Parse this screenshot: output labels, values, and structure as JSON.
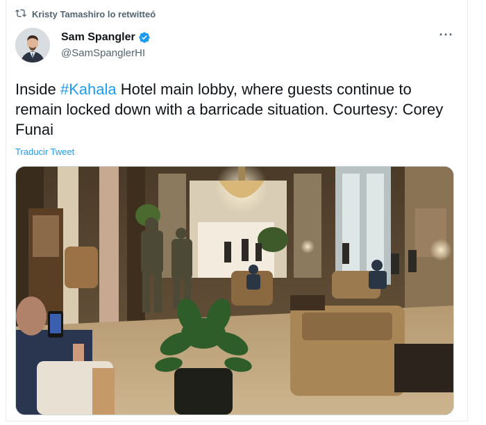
{
  "retweet": {
    "text": "Kristy Tamashiro lo retwitteó",
    "icon": "retweet-icon"
  },
  "author": {
    "display_name": "Sam Spangler",
    "handle": "@SamSpanglerHI",
    "verified_icon": "verified-badge-icon",
    "avatar_icon": "avatar"
  },
  "more_icon": "more-options-icon",
  "tweet": {
    "text_before": "Inside ",
    "hashtag": "#Kahala",
    "text_after": " Hotel main lobby, where guests continue to remain locked down with a barricade situation. Courtesy: Corey Funai"
  },
  "translate_label": "Traducir Tweet",
  "colors": {
    "link": "#1d9bf0",
    "secondary_text": "#536471",
    "primary_text": "#0f1419"
  }
}
